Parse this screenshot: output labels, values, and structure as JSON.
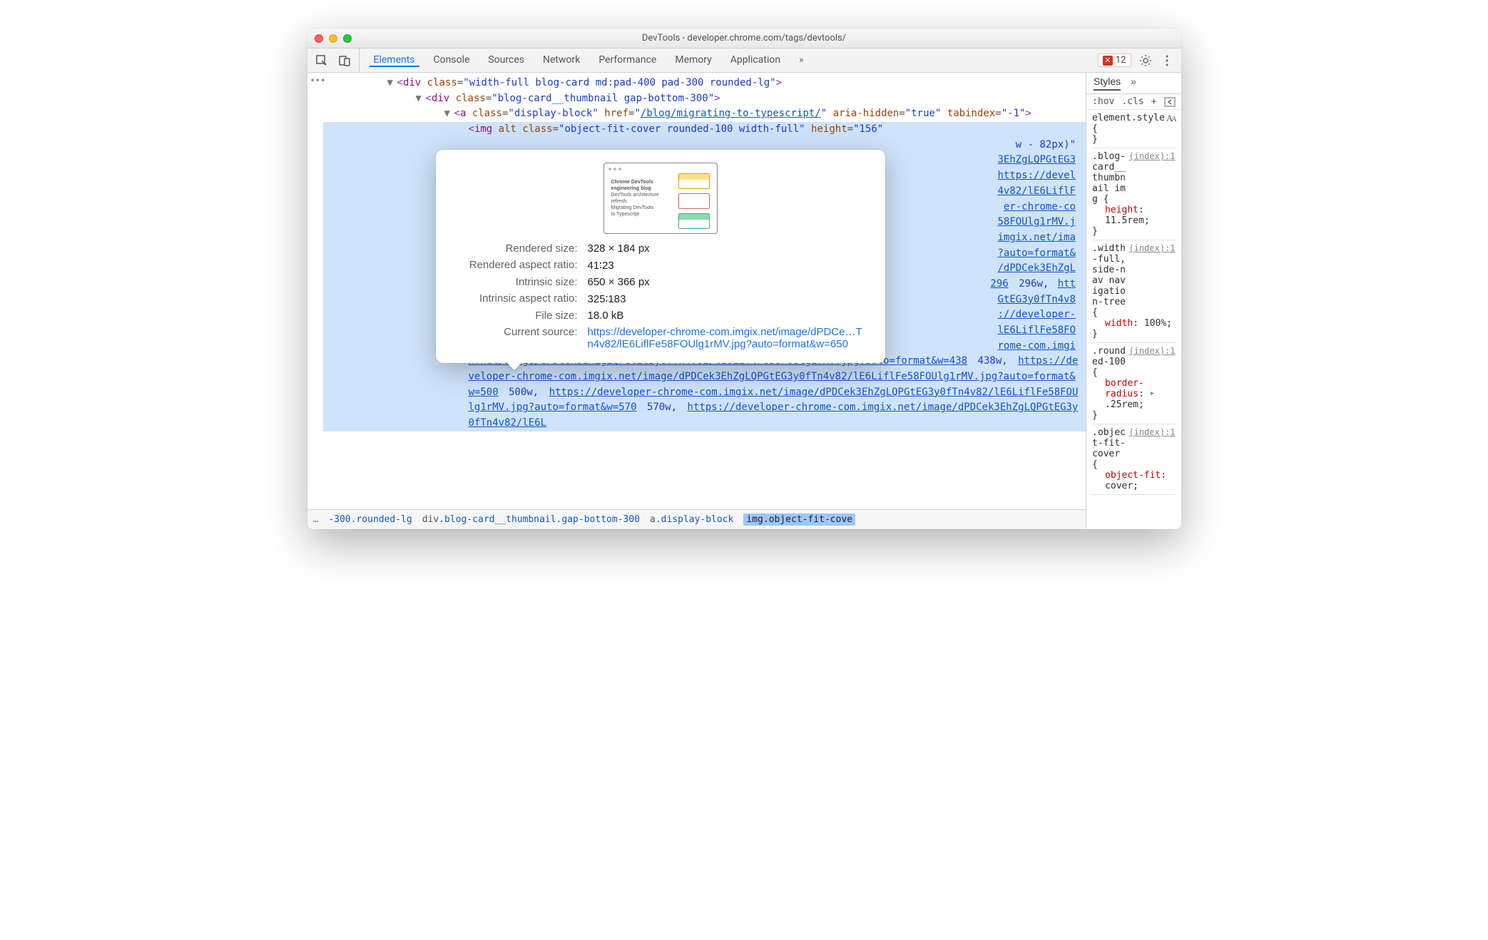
{
  "window": {
    "title": "DevTools - developer.chrome.com/tags/devtools/"
  },
  "toolbar": {
    "tabs": [
      "Elements",
      "Console",
      "Sources",
      "Network",
      "Performance",
      "Memory",
      "Application"
    ],
    "active_index": 0,
    "error_count": "12",
    "more_glyph": "»"
  },
  "dom": {
    "l1": {
      "tag": "div",
      "class": "width-full blog-card md:pad-400 pad-300 rounded-lg"
    },
    "l2": {
      "tag": "div",
      "class": "blog-card__thumbnail gap-bottom-300"
    },
    "l3": {
      "tag": "a",
      "class": "display-block",
      "href": "/blog/migrating-to-typescript/",
      "aria_hidden": "true",
      "tabindex": "-1"
    },
    "l4": {
      "tag": "img",
      "alt": "",
      "class": "object-fit-cover rounded-100 width-full",
      "height": "156"
    },
    "srcset_tail_1": "w - 82px)\"",
    "srcset_links": [
      "3EhZgLQPGtEG3",
      "https://devel",
      "4v82/lE6LiflF",
      "er-chrome-co",
      "58FOUlg1rMV.j",
      "imgix.net/ima",
      "?auto=format&",
      "/dPDCek3EhZgL",
      "296"
    ],
    "srcset_tail_2": "296w,",
    "srcset_tail_links2": [
      "htt",
      "GtEG3y0fTn4v8",
      "://developer-",
      "lE6LiflFe58FO",
      "rome-com.imgi"
    ],
    "lower_line1_pre": "x.net/image/dPDCek3EhZgLQPGtEG3y0fTn4v82/lE6LiflFe58FOUlg1rMV.jpg?auto=format&w=438",
    "lower_line1_mid": "438w,",
    "lower_line1_link": "https://developer-chrome-com.imgix.net/image/dPDCek3EhZgLQPGtEG3y0fTn4v82/lE6LiflFe58FOUlg1rMV.jpg?auto=format&w=500",
    "lower_line2_mid": "500w,",
    "lower_line2_link": "https://developer-chrome-com.imgix.net/image/dPDCek3EhZgLQPGtEG3y0fTn4v82/lE6LiflFe58FOUlg1rMV.jpg?auto=format&w=570",
    "lower_line3_mid": "570w,",
    "lower_line3_link": "https://developer-chrome-com.imgix.net/image/dPDCek3EhZgLQPGtEG3y0fTn4v82/lE6L"
  },
  "tooltip": {
    "thumb_title": "Chrome DevTools engineering blog",
    "thumb_sub": "DevTools architecture refresh:\nMigrating DevTools\nto Typescript",
    "rows": {
      "rendered_size_label": "Rendered size:",
      "rendered_size": "328 × 184 px",
      "rendered_ar_label": "Rendered aspect ratio:",
      "rendered_ar": "41∶23",
      "intrinsic_size_label": "Intrinsic size:",
      "intrinsic_size": "650 × 366 px",
      "intrinsic_ar_label": "Intrinsic aspect ratio:",
      "intrinsic_ar": "325∶183",
      "file_size_label": "File size:",
      "file_size": "18.0 kB",
      "current_source_label": "Current source:",
      "current_source": "https://developer-chrome-com.imgix.net/image/dPDCe…Tn4v82/lE6LiflFe58FOUlg1rMV.jpg?auto=format&w=650"
    }
  },
  "crumbs": {
    "ell": "…",
    "c1": "-300.rounded-lg",
    "c2_el": "div",
    "c2_cls": ".blog-card__thumbnail.gap-bottom-300",
    "c3_el": "a",
    "c3_cls": ".display-block",
    "c4_el": "img",
    "c4_cls": ".object-fit-cove"
  },
  "styles": {
    "tabs": {
      "styles": "Styles",
      "more": "»"
    },
    "toolbar": {
      "hov": ":hov",
      "cls": ".cls",
      "plus": "+"
    },
    "rules": [
      {
        "selector": "element.style",
        "source": "",
        "props": [],
        "open": "{",
        "close": "}",
        "fontsize": true
      },
      {
        "selector": ".blog-card__thumbnail img",
        "source": "(index):1",
        "props": [
          {
            "n": "height",
            "v": "11.5rem;"
          }
        ],
        "open": "{",
        "close": "}"
      },
      {
        "selector": ".width-full, side-nav navigation-tree",
        "source": "(index):1",
        "props": [
          {
            "n": "width",
            "v": "100%;"
          }
        ],
        "open": "{",
        "close": "}"
      },
      {
        "selector": ".rounded-100",
        "source": "(index):1",
        "props": [
          {
            "n": "border-radius",
            "v": ".25rem;",
            "tri": true
          }
        ],
        "open": "{",
        "close": "}"
      },
      {
        "selector": ".object-fit-cover",
        "source": "(index):1",
        "props": [
          {
            "n": "object-fit",
            "v": "cover;"
          }
        ],
        "open": "{",
        "close": ""
      }
    ]
  }
}
